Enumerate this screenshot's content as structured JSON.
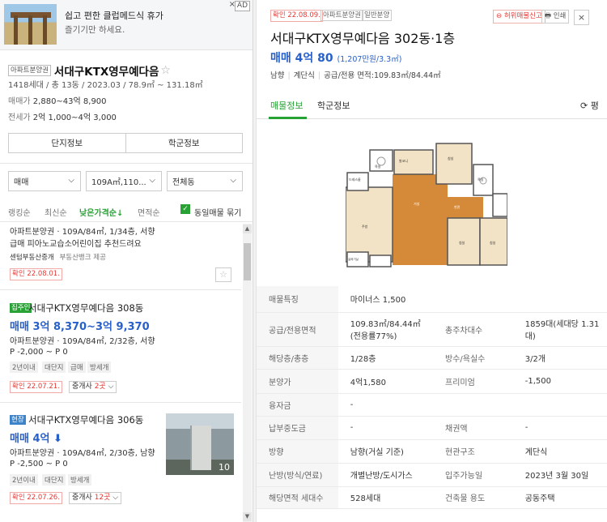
{
  "ad": {
    "title": "쉽고 편한 클럽메드식 휴가",
    "subtitle": "즐기기만 하세요.",
    "label": "AD",
    "close": "×"
  },
  "complex": {
    "tag": "아파트분양권",
    "name": "서대구KTX영무예다음",
    "star": "☆",
    "meta": "1418세대 / 총 13동 / 2023.03 / 78.9㎡ ~ 131.18㎡",
    "sale_label": "매매가",
    "sale_range": "2,880~43억 8,900",
    "jeonse_label": "전세가",
    "jeonse_range": "2억 1,000~4억 3,000",
    "btn_info": "단지정보",
    "btn_school": "학군정보"
  },
  "filters": {
    "trade": "매매",
    "area": "109A㎡,110...",
    "dong": "전체동",
    "chevron": "⌵"
  },
  "sort": {
    "ranking": "랭킹순",
    "latest": "최신순",
    "low_price": "낮은가격순↓",
    "area": "면적순",
    "check": "✓",
    "group": "동일매물 묶기"
  },
  "listings": [
    {
      "desc": "아파트분양권 · 109A/84㎡, 1/34층, 서향",
      "note": "급매 피아노교습소어린이집 추천드려요",
      "agent": "센텀부동산중개",
      "provider": "부동산뱅크 제공",
      "date": "확인 22.08.01."
    },
    {
      "cap": "집주인",
      "title": "서대구KTX영무예다음 308동",
      "price": "매매 3억 8,370~3억 9,370",
      "desc": "아파트분양권 · 109A/84㎡, 2/32층, 서향",
      "premium": "P -2,000 ~ P 0",
      "chips": [
        "2년이내",
        "대단지",
        "급매",
        "방세개"
      ],
      "date": "확인 22.07.21.",
      "broker_pre": "중개사 ",
      "broker_num": "2곳",
      "broker_post": " ⌵"
    },
    {
      "cap": "현장",
      "title": "서대구KTX영무예다음 306동",
      "price": "매매 4억",
      "price_arrow": "⬇",
      "desc": "아파트분양권 · 109A/84㎡, 2/30층, 남향",
      "premium": "P -2,500 ~ P 0",
      "chips": [
        "2년이내",
        "대단지",
        "방세개"
      ],
      "date": "확인 22.07.26.",
      "broker_pre": "중개사 ",
      "broker_num": "12곳",
      "broker_post": " ⌵",
      "photo_count": "10"
    }
  ],
  "detail": {
    "date": "확인 22.08.09.",
    "tags": [
      "아파트분양권",
      "일반분양"
    ],
    "report": "⊖ 허위매물신고",
    "print": "🖶 인쇄",
    "close": "×",
    "title": "서대구KTX영무예다음 302동·1층",
    "price": "매매 4억 80",
    "unit_price": "(1,207만원/3.3㎡)",
    "features": [
      "남향",
      "계단식",
      "공급/전용 면적:109.83㎡/84.44㎡"
    ],
    "tab_listing": "매물정보",
    "tab_school": "학군정보",
    "refresh": "⟳ 평",
    "floorplan": {
      "rooms": [
        "발코니",
        "드레스룸",
        "욕실",
        "침실",
        "거실",
        "주방",
        "침실",
        "침실",
        "현관",
        "욕실",
        "실외기실"
      ]
    },
    "specs": [
      {
        "k": "매물특징",
        "v": "마이너스 1,500"
      },
      {
        "k": "공급/전용면적",
        "v": "109.83㎡/84.44㎡(전용률77%)",
        "k2": "총주차대수",
        "v2": "1859대(세대당 1.31대)"
      },
      {
        "k": "해당층/총층",
        "v": "1/28층",
        "k2": "방수/욕실수",
        "v2": "3/2개"
      },
      {
        "k": "분양가",
        "v": "4억1,580",
        "k2": "프리미엄",
        "v2": "-1,500"
      },
      {
        "k": "융자금",
        "v": "-"
      },
      {
        "k": "납부중도금",
        "v": "-",
        "k2": "채권액",
        "v2": "-"
      },
      {
        "k": "방향",
        "v": "남향(거실 기준)",
        "k2": "현관구조",
        "v2": "계단식"
      },
      {
        "k": "난방(방식/연료)",
        "v": "개별난방/도시가스",
        "k2": "입주가능일",
        "v2": "2023년 3월 30일"
      },
      {
        "k": "해당면적 세대수",
        "v": "528세대",
        "k2": "건축물 용도",
        "v2": "공동주택"
      }
    ]
  }
}
